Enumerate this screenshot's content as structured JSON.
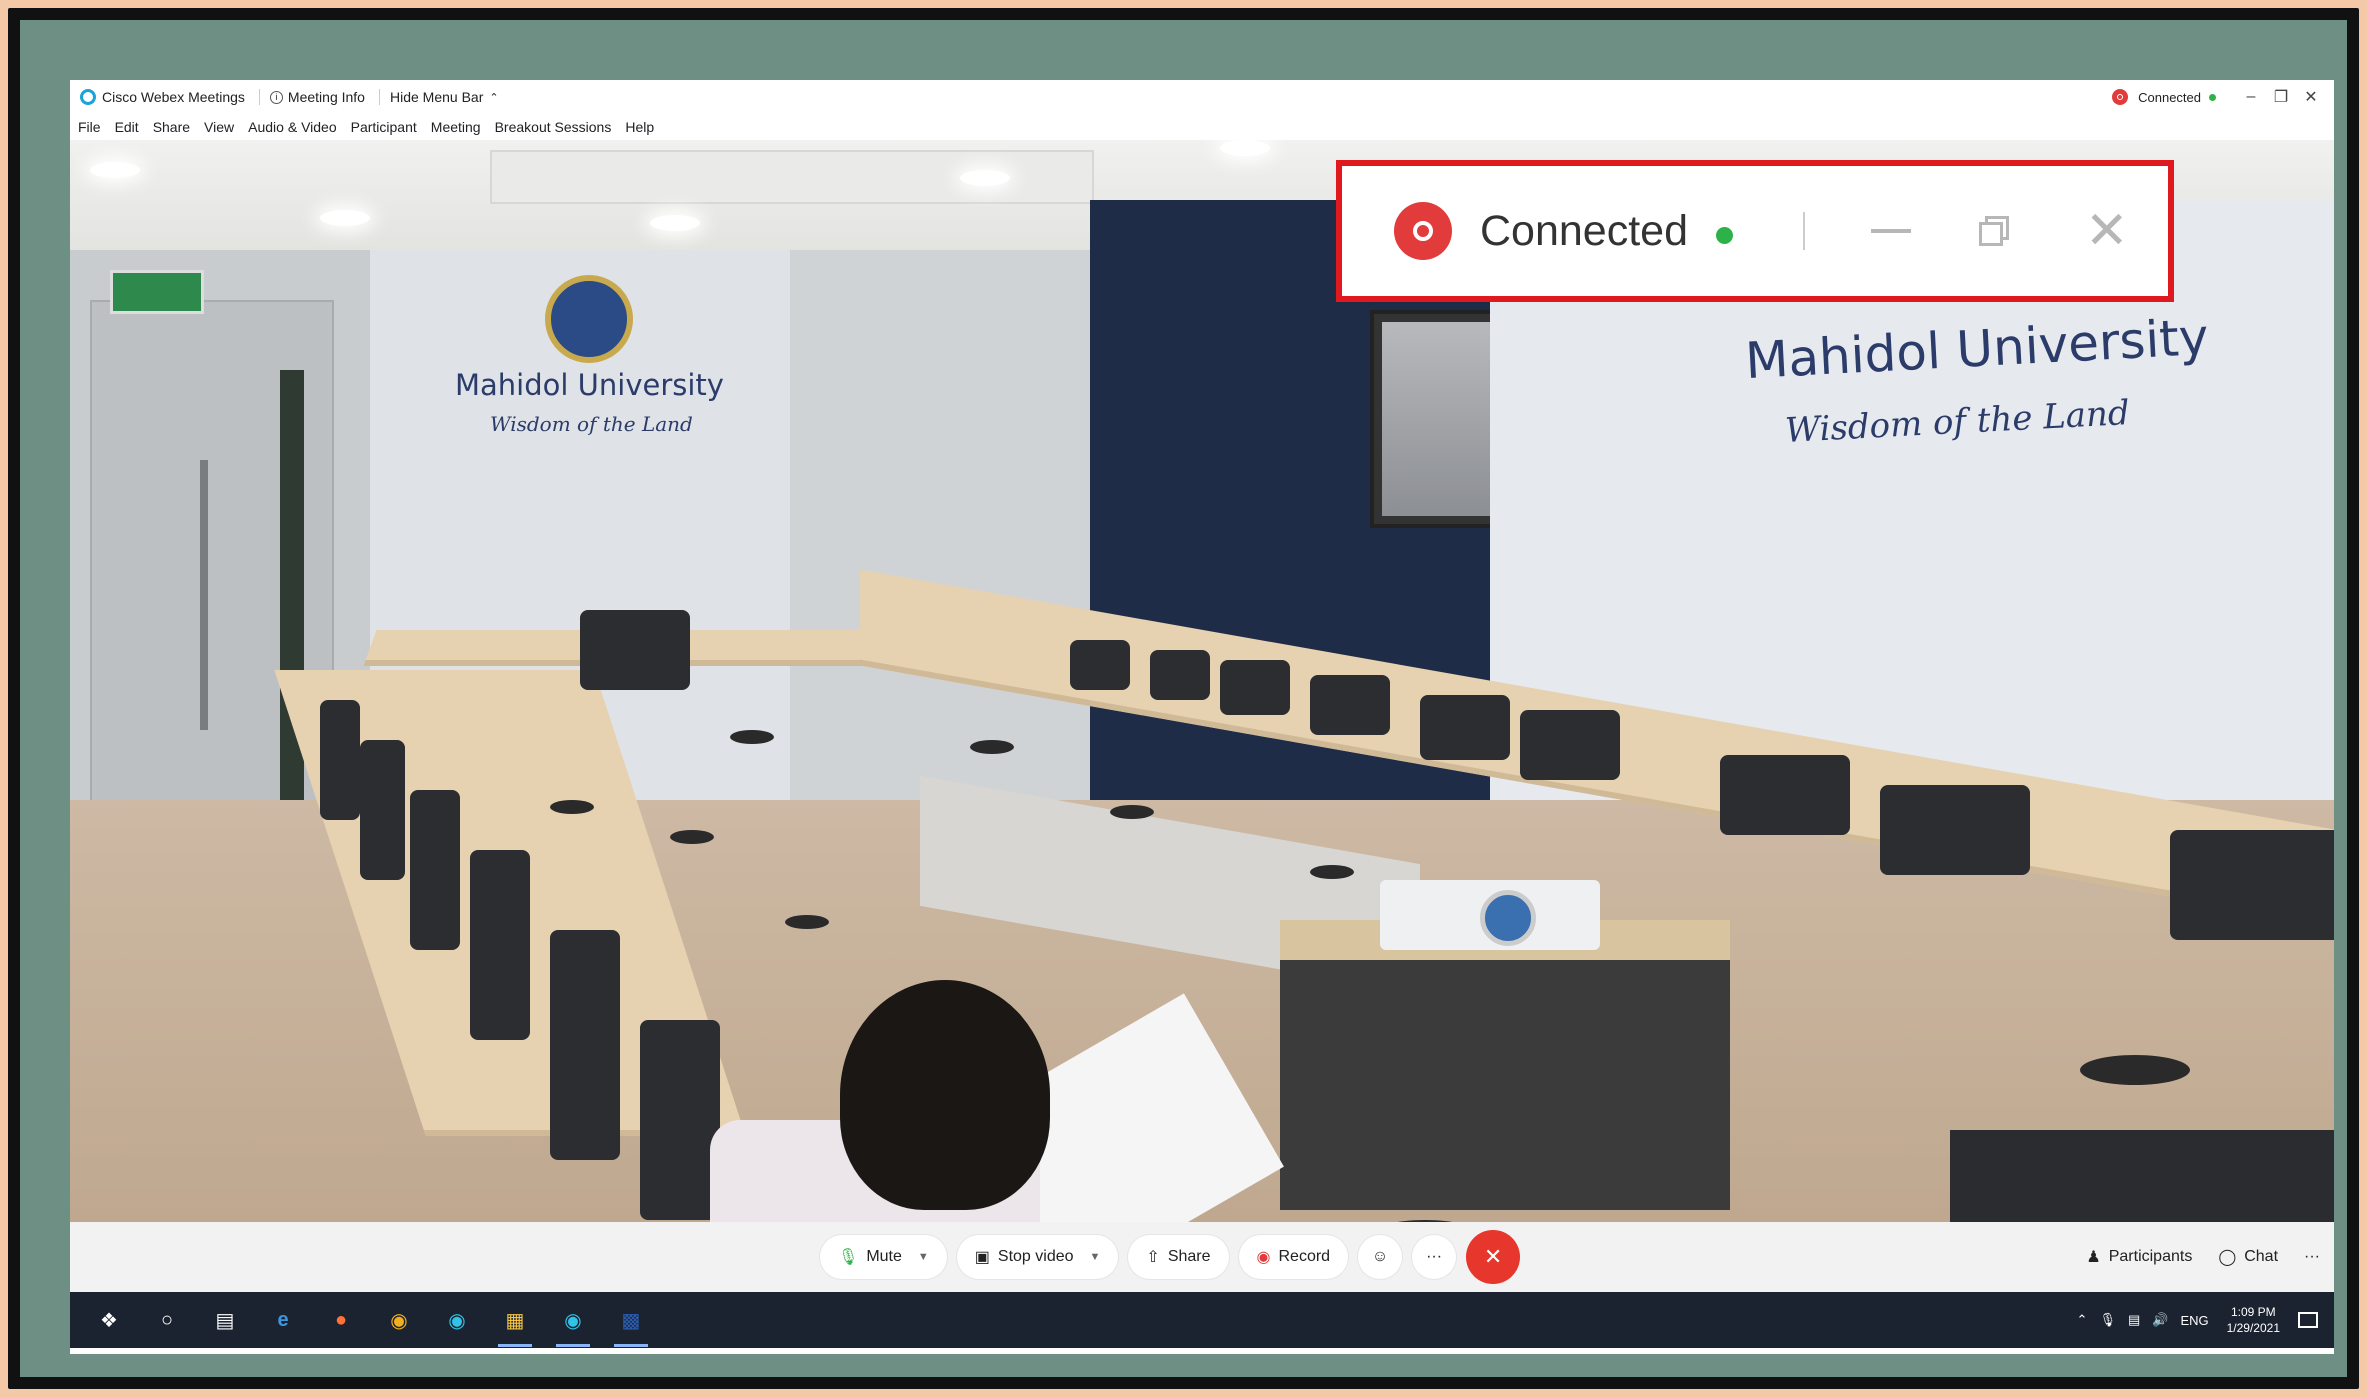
{
  "titlebar": {
    "app_title": "Cisco Webex Meetings",
    "meeting_info": "Meeting Info",
    "hide_menu_bar": "Hide Menu Bar",
    "status": "Connected",
    "minimize_icon": "minimize-icon",
    "restore_icon": "restore-icon",
    "close_icon": "close-icon"
  },
  "menubar": {
    "items": [
      "File",
      "Edit",
      "Share",
      "View",
      "Audio & Video",
      "Participant",
      "Meeting",
      "Breakout Sessions",
      "Help"
    ]
  },
  "room": {
    "university_name": "Mahidol University",
    "motto": "Wisdom of the Land"
  },
  "callout": {
    "status": "Connected",
    "border_color": "#e0191e",
    "status_dot_color": "#2db24a",
    "record_color": "#e23b3b"
  },
  "controls": {
    "mute": "Mute",
    "stop_video": "Stop video",
    "share": "Share",
    "record": "Record",
    "reactions_icon": "emoji-icon",
    "more": "···",
    "end_call_icon": "close-icon",
    "participants": "Participants",
    "chat": "Chat",
    "overflow": "···"
  },
  "taskbar": {
    "apps": [
      "windows-start-icon",
      "search-icon",
      "task-view-icon",
      "edge-icon",
      "firefox-icon",
      "chrome-icon",
      "webex-app-icon",
      "file-explorer-icon",
      "webex-meetings-icon",
      "word-icon"
    ],
    "language": "ENG",
    "time": "1:09 PM",
    "date": "1/29/2021"
  }
}
